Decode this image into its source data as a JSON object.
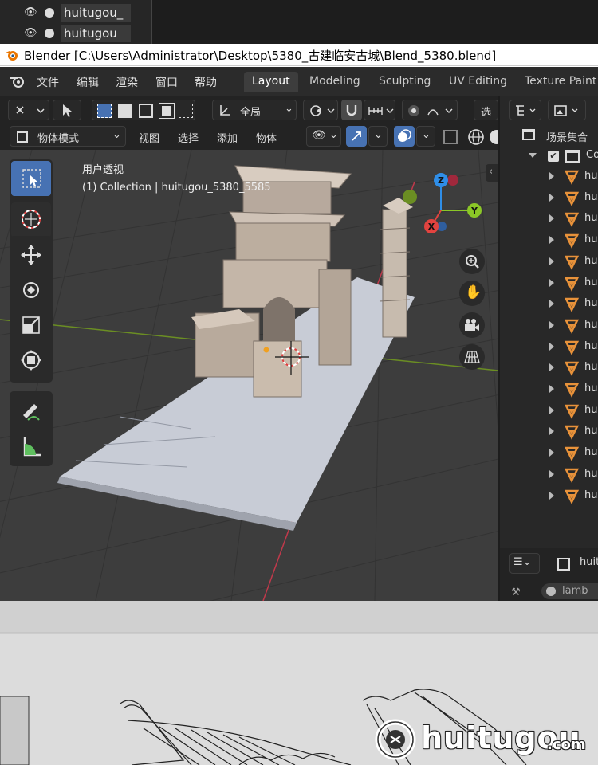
{
  "top_outliner": {
    "items": [
      {
        "label": "huitugou_"
      },
      {
        "label": "huitugou"
      }
    ]
  },
  "titlebar": {
    "title": "Blender [C:\\Users\\Administrator\\Desktop\\5380_古建临安古城\\Blend_5380.blend]"
  },
  "menubar": {
    "items": [
      "文件",
      "编辑",
      "渲染",
      "窗口",
      "帮助"
    ]
  },
  "workspaces": [
    {
      "label": "Layout",
      "active": true
    },
    {
      "label": "Modeling"
    },
    {
      "label": "Sculpting"
    },
    {
      "label": "UV Editing"
    },
    {
      "label": "Texture Paint"
    }
  ],
  "header": {
    "transform_orientation": "全局",
    "select_truncated": "选",
    "mode": "物体模式",
    "menu": [
      "视图",
      "选择",
      "添加",
      "物体"
    ]
  },
  "viewport": {
    "view_name": "用户透视",
    "collection_info": "(1) Collection | huitugou_5380_5585",
    "gizmo_axes": [
      "Z",
      "Y",
      "X"
    ],
    "colors": {
      "x": "#e2433f",
      "y": "#8bc727",
      "z": "#2f8ee8",
      "accent": "#4772b3"
    }
  },
  "outliner": {
    "title": "场景集合",
    "collection_label": "Co",
    "item_prefix": "hu",
    "item_count": 16
  },
  "properties": {
    "name_truncated": "huit",
    "material_truncated": "lamb"
  },
  "watermark": {
    "brand": "huitugou",
    "suffix": ".com"
  }
}
